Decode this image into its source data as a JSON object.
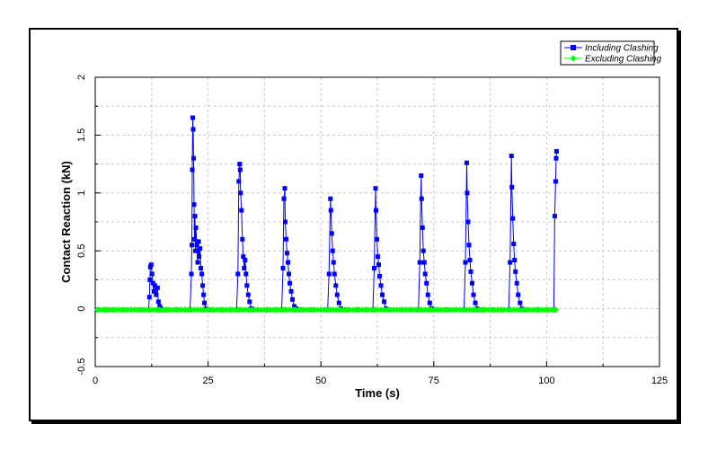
{
  "chart_data": {
    "type": "line",
    "title": "",
    "xlabel": "Time (s)",
    "ylabel": "Contact Reaction (kN)",
    "xlim": [
      0,
      125
    ],
    "ylim": [
      -0.5,
      2
    ],
    "xticks": [
      "0",
      "25",
      "50",
      "75",
      "100",
      "125"
    ],
    "yticks": [
      "-0.5",
      "0",
      "0.5",
      "1",
      "1.5",
      "2"
    ],
    "grid": true,
    "legend_position": "top-right",
    "series": [
      {
        "name": "Including Clashing",
        "color": "#0000ff",
        "marker": "square",
        "points": [
          [
            0.5,
            -0.01
          ],
          [
            3,
            -0.01
          ],
          [
            6.5,
            -0.01
          ],
          [
            10,
            -0.01
          ],
          [
            11.8,
            -0.01
          ],
          [
            12.0,
            0.1
          ],
          [
            12.1,
            0.25
          ],
          [
            12.2,
            0.36
          ],
          [
            12.4,
            0.38
          ],
          [
            12.6,
            0.3
          ],
          [
            12.8,
            0.22
          ],
          [
            13.0,
            0.15
          ],
          [
            13.2,
            0.2
          ],
          [
            13.5,
            0.12
          ],
          [
            13.8,
            0.18
          ],
          [
            14.0,
            0.06
          ],
          [
            14.3,
            0.02
          ],
          [
            14.6,
            0.0
          ],
          [
            15,
            -0.01
          ],
          [
            18,
            -0.01
          ],
          [
            21.0,
            -0.01
          ],
          [
            21.3,
            0.3
          ],
          [
            21.4,
            0.55
          ],
          [
            21.5,
            1.2
          ],
          [
            21.6,
            1.65
          ],
          [
            21.7,
            1.55
          ],
          [
            21.8,
            1.3
          ],
          [
            21.9,
            0.9
          ],
          [
            22.0,
            0.6
          ],
          [
            22.1,
            0.8
          ],
          [
            22.2,
            0.5
          ],
          [
            22.3,
            0.7
          ],
          [
            22.5,
            0.55
          ],
          [
            22.7,
            0.4
          ],
          [
            22.9,
            0.58
          ],
          [
            23.0,
            0.45
          ],
          [
            23.2,
            0.52
          ],
          [
            23.4,
            0.35
          ],
          [
            23.6,
            0.3
          ],
          [
            23.8,
            0.2
          ],
          [
            24.0,
            0.12
          ],
          [
            24.2,
            0.05
          ],
          [
            24.5,
            0.0
          ],
          [
            25,
            -0.01
          ],
          [
            28,
            -0.01
          ],
          [
            31.3,
            -0.01
          ],
          [
            31.6,
            0.3
          ],
          [
            31.8,
            1.1
          ],
          [
            32.0,
            1.25
          ],
          [
            32.1,
            1.2
          ],
          [
            32.2,
            1.0
          ],
          [
            32.4,
            0.85
          ],
          [
            32.6,
            0.6
          ],
          [
            32.8,
            0.45
          ],
          [
            33.0,
            0.35
          ],
          [
            33.2,
            0.42
          ],
          [
            33.4,
            0.3
          ],
          [
            33.6,
            0.2
          ],
          [
            33.9,
            0.12
          ],
          [
            34.2,
            0.06
          ],
          [
            34.6,
            0.0
          ],
          [
            35,
            -0.01
          ],
          [
            38,
            -0.01
          ],
          [
            41.3,
            -0.01
          ],
          [
            41.6,
            0.35
          ],
          [
            41.8,
            0.95
          ],
          [
            42.0,
            1.04
          ],
          [
            42.1,
            0.75
          ],
          [
            42.3,
            0.6
          ],
          [
            42.5,
            0.48
          ],
          [
            42.7,
            0.4
          ],
          [
            42.9,
            0.3
          ],
          [
            43.1,
            0.22
          ],
          [
            43.4,
            0.15
          ],
          [
            43.7,
            0.08
          ],
          [
            44.1,
            0.02
          ],
          [
            44.5,
            0.0
          ],
          [
            45,
            -0.01
          ],
          [
            48,
            -0.01
          ],
          [
            51.5,
            -0.01
          ],
          [
            51.8,
            0.3
          ],
          [
            52.1,
            0.95
          ],
          [
            52.2,
            0.85
          ],
          [
            52.4,
            0.65
          ],
          [
            52.6,
            0.5
          ],
          [
            52.8,
            0.4
          ],
          [
            53.0,
            0.3
          ],
          [
            53.3,
            0.2
          ],
          [
            53.6,
            0.12
          ],
          [
            54.0,
            0.05
          ],
          [
            54.4,
            0.0
          ],
          [
            55,
            -0.01
          ],
          [
            58,
            -0.01
          ],
          [
            61.5,
            -0.01
          ],
          [
            61.8,
            0.35
          ],
          [
            62.1,
            1.04
          ],
          [
            62.2,
            0.85
          ],
          [
            62.4,
            0.6
          ],
          [
            62.6,
            0.45
          ],
          [
            62.8,
            0.38
          ],
          [
            63.0,
            0.28
          ],
          [
            63.3,
            0.2
          ],
          [
            63.6,
            0.12
          ],
          [
            64.0,
            0.06
          ],
          [
            64.4,
            0.0
          ],
          [
            65,
            -0.01
          ],
          [
            68,
            -0.01
          ],
          [
            71.6,
            -0.01
          ],
          [
            71.9,
            0.4
          ],
          [
            72.2,
            1.15
          ],
          [
            72.3,
            0.95
          ],
          [
            72.5,
            0.7
          ],
          [
            72.7,
            0.5
          ],
          [
            72.9,
            0.4
          ],
          [
            73.1,
            0.3
          ],
          [
            73.4,
            0.22
          ],
          [
            73.7,
            0.12
          ],
          [
            74.1,
            0.05
          ],
          [
            74.5,
            0.0
          ],
          [
            75,
            -0.01
          ],
          [
            78,
            -0.01
          ],
          [
            81.7,
            -0.01
          ],
          [
            82.0,
            0.4
          ],
          [
            82.3,
            1.26
          ],
          [
            82.4,
            1.0
          ],
          [
            82.6,
            0.75
          ],
          [
            82.8,
            0.55
          ],
          [
            83.0,
            0.42
          ],
          [
            83.2,
            0.32
          ],
          [
            83.5,
            0.22
          ],
          [
            83.8,
            0.12
          ],
          [
            84.2,
            0.05
          ],
          [
            84.6,
            0.0
          ],
          [
            85,
            -0.01
          ],
          [
            88,
            -0.01
          ],
          [
            91.6,
            -0.01
          ],
          [
            91.9,
            0.4
          ],
          [
            92.2,
            1.32
          ],
          [
            92.3,
            1.05
          ],
          [
            92.5,
            0.78
          ],
          [
            92.7,
            0.56
          ],
          [
            92.9,
            0.42
          ],
          [
            93.1,
            0.32
          ],
          [
            93.4,
            0.22
          ],
          [
            93.7,
            0.12
          ],
          [
            94.1,
            0.05
          ],
          [
            94.5,
            0.0
          ],
          [
            95,
            -0.01
          ],
          [
            98,
            -0.01
          ],
          [
            101.6,
            -0.01
          ],
          [
            101.8,
            0.8
          ],
          [
            102.0,
            1.1
          ],
          [
            102.1,
            1.3
          ],
          [
            102.2,
            1.36
          ]
        ]
      },
      {
        "name": "Excluding Clashing",
        "color": "#00ff00",
        "marker": "diamond",
        "points": [
          [
            0.5,
            -0.01
          ],
          [
            2,
            -0.01
          ],
          [
            4,
            -0.01
          ],
          [
            6,
            -0.01
          ],
          [
            8,
            -0.01
          ],
          [
            10,
            -0.01
          ],
          [
            12,
            -0.01
          ],
          [
            14,
            -0.01
          ],
          [
            16,
            -0.01
          ],
          [
            18,
            -0.01
          ],
          [
            20,
            -0.01
          ],
          [
            22,
            -0.01
          ],
          [
            24,
            -0.01
          ],
          [
            26,
            -0.01
          ],
          [
            28,
            -0.01
          ],
          [
            30,
            -0.01
          ],
          [
            32,
            -0.01
          ],
          [
            34,
            -0.01
          ],
          [
            36,
            -0.01
          ],
          [
            38,
            -0.01
          ],
          [
            40,
            -0.01
          ],
          [
            42,
            -0.01
          ],
          [
            44,
            -0.01
          ],
          [
            46,
            -0.01
          ],
          [
            48,
            -0.01
          ],
          [
            50,
            -0.01
          ],
          [
            52,
            -0.01
          ],
          [
            54,
            -0.01
          ],
          [
            56,
            -0.01
          ],
          [
            58,
            -0.01
          ],
          [
            60,
            -0.01
          ],
          [
            62,
            -0.01
          ],
          [
            64,
            -0.01
          ],
          [
            66,
            -0.01
          ],
          [
            68,
            -0.01
          ],
          [
            70,
            -0.01
          ],
          [
            72,
            -0.01
          ],
          [
            74,
            -0.01
          ],
          [
            76,
            -0.01
          ],
          [
            78,
            -0.01
          ],
          [
            80,
            -0.01
          ],
          [
            82,
            -0.01
          ],
          [
            84,
            -0.01
          ],
          [
            86,
            -0.01
          ],
          [
            88,
            -0.01
          ],
          [
            90,
            -0.01
          ],
          [
            92,
            -0.01
          ],
          [
            94,
            -0.01
          ],
          [
            96,
            -0.01
          ],
          [
            98,
            -0.01
          ],
          [
            100,
            -0.01
          ],
          [
            102,
            -0.01
          ]
        ]
      }
    ]
  }
}
